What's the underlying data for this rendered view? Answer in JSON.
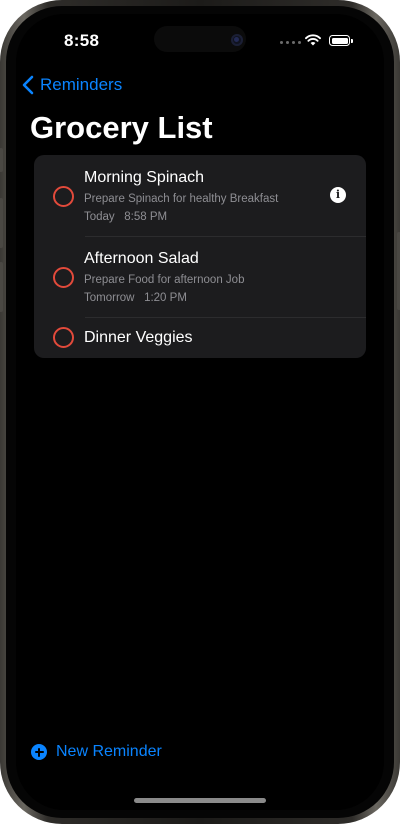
{
  "status_bar": {
    "time": "8:58"
  },
  "navigation": {
    "back_label": "Reminders"
  },
  "list": {
    "title": "Grocery List",
    "items": [
      {
        "title": "Morning Spinach",
        "notes": "Prepare Spinach for healthy Breakfast",
        "due": "Today   8:58 PM",
        "info_icon": "info-icon"
      },
      {
        "title": "Afternoon Salad",
        "notes": "Prepare Food for afternoon Job",
        "due": "Tomorrow   1:20 PM"
      },
      {
        "title": "Dinner Veggies"
      }
    ]
  },
  "toolbar": {
    "new_reminder_label": "New Reminder"
  },
  "colors": {
    "accent": "#0a84ff",
    "checkbox": "#e24a3b",
    "card_background": "#1c1c1e",
    "secondary_text": "#8e8e93"
  }
}
